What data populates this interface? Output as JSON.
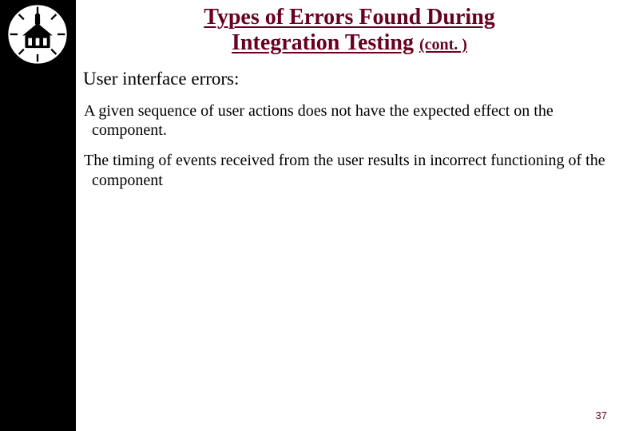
{
  "title": {
    "line1": "Types of Errors Found During",
    "line2_main": "Integration Testing",
    "line2_cont": "(cont. )"
  },
  "bullet": {
    "heading": "User interface errors:"
  },
  "paragraphs": {
    "p1": "A given sequence of user actions does not have the expected effect on the component.",
    "p2": "The timing of events received from the user results in incorrect functioning of the component"
  },
  "page_number": "37"
}
